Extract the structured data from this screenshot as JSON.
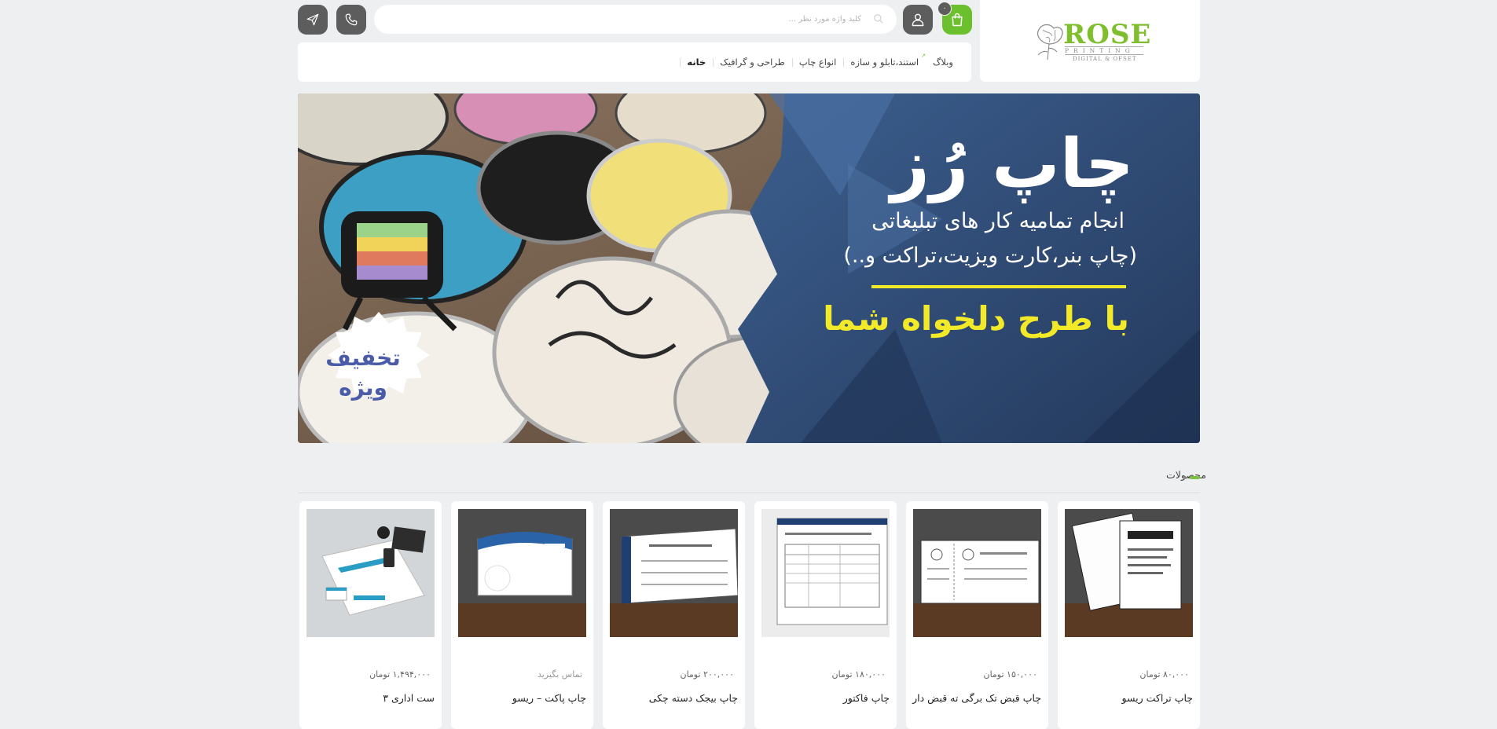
{
  "header": {
    "logo": {
      "word": "ROSE",
      "sub1": "PRINTING",
      "sub2": "DIGITAL & OFSET"
    },
    "cart_count": "۰",
    "search_placeholder": "کلید واژه مورد نظر ..."
  },
  "nav": {
    "items": [
      {
        "label": "خانه",
        "active": true
      },
      {
        "label": "طراحی و گرافیک",
        "active": false
      },
      {
        "label": "انواع چاپ",
        "active": false
      },
      {
        "label": "استند،تابلو و سازه",
        "active": false
      },
      {
        "label": "وبلاگ",
        "active": false
      }
    ]
  },
  "banner": {
    "title": "چاپ رُز",
    "line1": "انجام تمامیه کار های تبلیغاتی",
    "line2": "(چاپ بنر،کارت ویزیت،تراکت و..)",
    "line3": "با طرح دلخواه شما",
    "badge_line1": "تخفیف",
    "badge_line2": "ویژه"
  },
  "section": {
    "title": "محصولات"
  },
  "products": [
    {
      "name": "چاپ تراکت ریسو",
      "price": "۸۰,۰۰۰ تومان",
      "image": "flyers-image"
    },
    {
      "name": "چاپ قبض تک برگی ته قبض دار",
      "price": "۱۵۰,۰۰۰ تومان",
      "image": "receipt-image"
    },
    {
      "name": "چاپ فاکتور",
      "price": "۱۸۰,۰۰۰ تومان",
      "image": "invoice-image"
    },
    {
      "name": "چاپ بیجک دسته چکی",
      "price": "۲۰۰,۰۰۰ تومان",
      "image": "checkbook-image"
    },
    {
      "name": "چاپ پاکت – ریسو",
      "price": "تماس بگیرید",
      "image": "envelope-image"
    },
    {
      "name": "ست اداری ۳",
      "price": "۱,۴۹۴,۰۰۰ تومان",
      "image": "office-set-image"
    }
  ],
  "colors": {
    "accent": "#6cc02e",
    "dark_button": "#5d5d5d",
    "banner_blue": "#2f4f7a",
    "banner_yellow": "#f2ea28"
  }
}
